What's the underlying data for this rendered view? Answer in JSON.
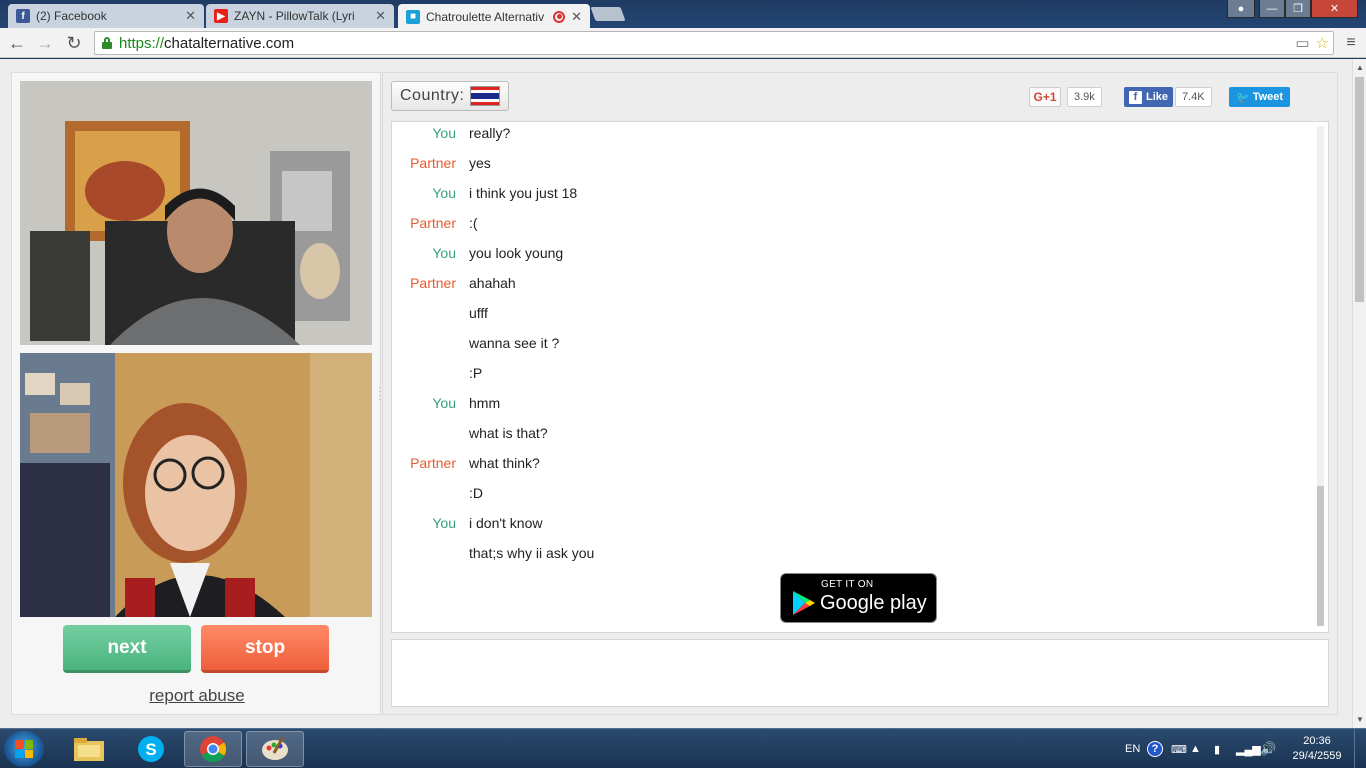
{
  "browser": {
    "tabs": [
      {
        "label": "(2) Facebook",
        "icon": "facebook-icon",
        "color": "#3b5998"
      },
      {
        "label": "ZAYN - PillowTalk (Lyri",
        "icon": "youtube-icon",
        "color": "#e62117"
      },
      {
        "label": "Chatroulette Alternativ",
        "icon": "video-camera-icon",
        "color": "#1aa1d8",
        "active": true
      }
    ],
    "url_secure": "https://",
    "url_host": "chatalternative.com"
  },
  "left": {
    "next_label": "next",
    "stop_label": "stop",
    "report_label": "report abuse"
  },
  "header": {
    "country_label": "Country:",
    "country_flag": "thailand-flag",
    "gplus_label": "G+1",
    "gplus_count": "3.9k",
    "fb_label": "Like",
    "fb_count": "7.4K",
    "tweet_label": "Tweet"
  },
  "chat": {
    "messages": [
      {
        "who": "You",
        "text": "really?"
      },
      {
        "who": "Partner",
        "text": "yes"
      },
      {
        "who": "You",
        "text": "i think you just 18"
      },
      {
        "who": "Partner",
        "text": ":("
      },
      {
        "who": "You",
        "text": "you look young"
      },
      {
        "who": "Partner",
        "text": "ahahah"
      },
      {
        "who": "",
        "text": "ufff"
      },
      {
        "who": "",
        "text": "wanna see it ?"
      },
      {
        "who": "",
        "text": ":P"
      },
      {
        "who": "You",
        "text": "hmm"
      },
      {
        "who": "",
        "text": "what is that?"
      },
      {
        "who": "Partner",
        "text": "what think?"
      },
      {
        "who": "",
        "text": ":D"
      },
      {
        "who": "You",
        "text": "i don't know"
      },
      {
        "who": "",
        "text": "that;s why ii ask you"
      }
    ],
    "gplay_small": "GET IT ON",
    "gplay_big": "Google play"
  },
  "taskbar": {
    "lang": "EN",
    "time": "20:36",
    "date": "29/4/2559"
  },
  "colors": {
    "you": "#3aa17a",
    "partner": "#e45b30",
    "next": "#5cc08d",
    "stop": "#f46f4b"
  }
}
